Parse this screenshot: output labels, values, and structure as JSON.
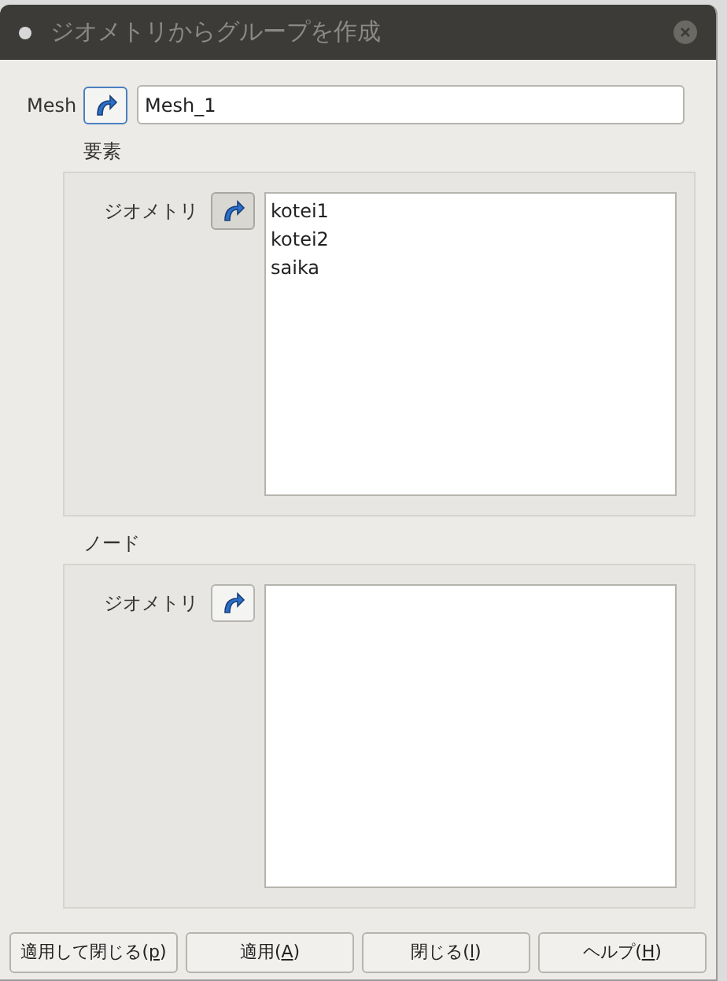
{
  "window": {
    "title": "ジオメトリからグループを作成"
  },
  "mesh": {
    "label": "Mesh",
    "select_active": true,
    "value": "Mesh_1"
  },
  "groups": [
    {
      "title": "要素",
      "label": "ジオメトリ",
      "select_pressed": true,
      "items": [
        "kotei1",
        "kotei2",
        "saika"
      ]
    },
    {
      "title": "ノード",
      "label": "ジオメトリ",
      "select_pressed": false
    }
  ],
  "buttons": [
    {
      "before": "適用して閉じる(",
      "key": "p",
      "after": ")"
    },
    {
      "before": "適用(",
      "key": "A",
      "after": ")"
    },
    {
      "before": "閉じる(",
      "key": "l",
      "after": ")"
    },
    {
      "before": "ヘルプ(",
      "key": "H",
      "after": ")"
    }
  ]
}
